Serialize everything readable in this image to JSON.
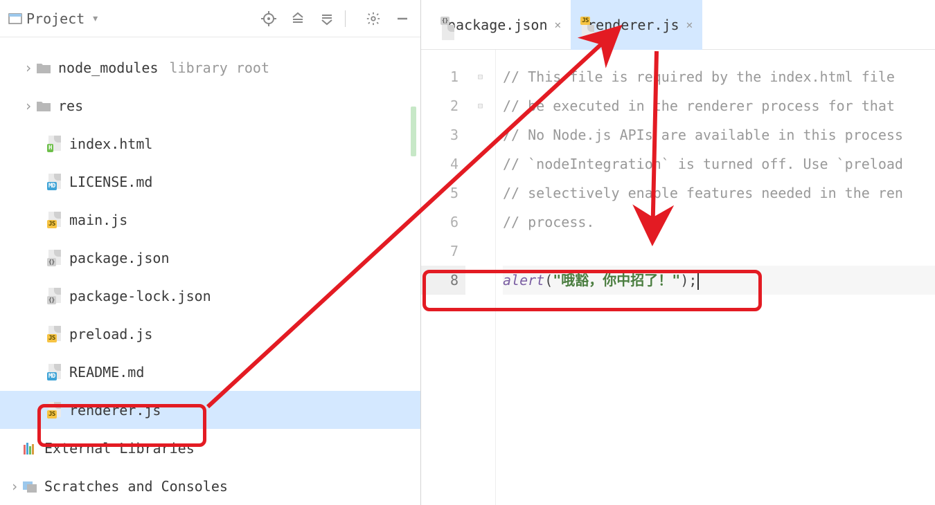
{
  "sidebar": {
    "view_mode": "Project",
    "items": [
      {
        "icon": "folder",
        "label": "node_modules",
        "suffix": "library root",
        "expandable": true
      },
      {
        "icon": "folder",
        "label": "res",
        "expandable": true
      },
      {
        "icon": "html",
        "label": "index.html"
      },
      {
        "icon": "md",
        "label": "LICENSE.md"
      },
      {
        "icon": "js",
        "label": "main.js"
      },
      {
        "icon": "json",
        "label": "package.json"
      },
      {
        "icon": "json",
        "label": "package-lock.json"
      },
      {
        "icon": "js",
        "label": "preload.js"
      },
      {
        "icon": "md",
        "label": "README.md"
      },
      {
        "icon": "js",
        "label": "renderer.js",
        "selected": true
      }
    ],
    "bottom": [
      {
        "icon": "libs",
        "label": "External Libraries"
      },
      {
        "icon": "scratch",
        "label": "Scratches and Consoles",
        "expandable": true
      }
    ]
  },
  "tabs": [
    {
      "icon": "json",
      "label": "package.json",
      "active": false
    },
    {
      "icon": "js",
      "label": "renderer.js",
      "active": true
    }
  ],
  "code": {
    "lines": [
      {
        "n": 1,
        "comment": "// This file is required by the index.html file "
      },
      {
        "n": 2,
        "comment": "// be executed in the renderer process for that "
      },
      {
        "n": 3,
        "comment": "// No Node.js APIs are available in this process "
      },
      {
        "n": 4,
        "comment": "// `nodeIntegration` is turned off. Use `preload"
      },
      {
        "n": 5,
        "comment": "// selectively enable features needed in the ren"
      },
      {
        "n": 6,
        "comment": "// process."
      },
      {
        "n": 7,
        "blank": true
      }
    ],
    "alert_line": {
      "n": 8,
      "func": "alert",
      "open": "(",
      "str": "\"哦豁，你中招了！\"",
      "close": ");"
    }
  }
}
